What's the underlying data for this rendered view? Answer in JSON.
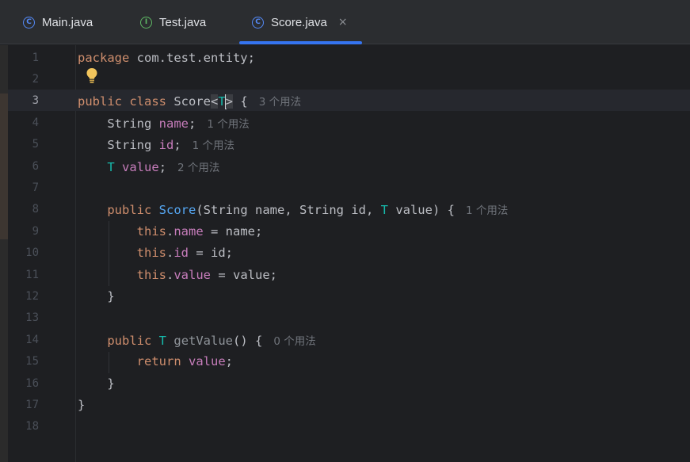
{
  "tabs": [
    {
      "label": "Main.java",
      "icon": "C"
    },
    {
      "label": "Test.java",
      "icon": "I"
    },
    {
      "label": "Score.java",
      "icon": "C",
      "close": "×"
    }
  ],
  "lines": [
    {
      "n": "1",
      "tokens": [
        {
          "t": "package",
          "c": "kw"
        },
        {
          "t": " com.test.entity;"
        }
      ]
    },
    {
      "n": "2",
      "tokens": []
    },
    {
      "n": "3",
      "tokens": [
        {
          "t": "public class",
          "c": "kw"
        },
        {
          "t": " Score"
        },
        {
          "t": "<",
          "c": "bracket-hl"
        },
        {
          "t": "T",
          "c": "tp"
        },
        {
          "caret": true
        },
        {
          "t": ">",
          "c": "bracket-hl"
        },
        {
          "t": " {"
        }
      ],
      "hint": "3 个用法"
    },
    {
      "n": "4",
      "tokens": [
        {
          "t": "    String "
        },
        {
          "t": "name",
          "c": "fld"
        },
        {
          "t": ";"
        }
      ],
      "hint": "1 个用法"
    },
    {
      "n": "5",
      "tokens": [
        {
          "t": "    String "
        },
        {
          "t": "id",
          "c": "fld"
        },
        {
          "t": ";"
        }
      ],
      "hint": "1 个用法"
    },
    {
      "n": "6",
      "tokens": [
        {
          "t": "    "
        },
        {
          "t": "T",
          "c": "tp"
        },
        {
          "t": " "
        },
        {
          "t": "value",
          "c": "fld"
        },
        {
          "t": ";"
        }
      ],
      "hint": "2 个用法"
    },
    {
      "n": "7",
      "tokens": []
    },
    {
      "n": "8",
      "tokens": [
        {
          "t": "    "
        },
        {
          "t": "public",
          "c": "kw"
        },
        {
          "t": " "
        },
        {
          "t": "Score",
          "c": "fn"
        },
        {
          "t": "(String name, String id, "
        },
        {
          "t": "T",
          "c": "tp"
        },
        {
          "t": " value) {"
        }
      ],
      "hint": "1 个用法"
    },
    {
      "n": "9",
      "tokens": [
        {
          "t": "        "
        },
        {
          "t": "this",
          "c": "kw"
        },
        {
          "t": "."
        },
        {
          "t": "name",
          "c": "fld"
        },
        {
          "t": " = name;"
        }
      ]
    },
    {
      "n": "10",
      "tokens": [
        {
          "t": "        "
        },
        {
          "t": "this",
          "c": "kw"
        },
        {
          "t": "."
        },
        {
          "t": "id",
          "c": "fld"
        },
        {
          "t": " = id;"
        }
      ]
    },
    {
      "n": "11",
      "tokens": [
        {
          "t": "        "
        },
        {
          "t": "this",
          "c": "kw"
        },
        {
          "t": "."
        },
        {
          "t": "value",
          "c": "fld"
        },
        {
          "t": " = value;"
        }
      ]
    },
    {
      "n": "12",
      "tokens": [
        {
          "t": "    }"
        }
      ]
    },
    {
      "n": "13",
      "tokens": []
    },
    {
      "n": "14",
      "tokens": [
        {
          "t": "    "
        },
        {
          "t": "public",
          "c": "kw"
        },
        {
          "t": " "
        },
        {
          "t": "T",
          "c": "tp"
        },
        {
          "t": " "
        },
        {
          "t": "getValue",
          "c": "ufn"
        },
        {
          "t": "() {"
        }
      ],
      "hint": "0 个用法"
    },
    {
      "n": "15",
      "tokens": [
        {
          "t": "        "
        },
        {
          "t": "return",
          "c": "kw"
        },
        {
          "t": " "
        },
        {
          "t": "value",
          "c": "fld"
        },
        {
          "t": ";"
        }
      ]
    },
    {
      "n": "16",
      "tokens": [
        {
          "t": "    }"
        }
      ]
    },
    {
      "n": "17",
      "tokens": [
        {
          "t": "}"
        }
      ]
    },
    {
      "n": "18",
      "tokens": []
    }
  ]
}
